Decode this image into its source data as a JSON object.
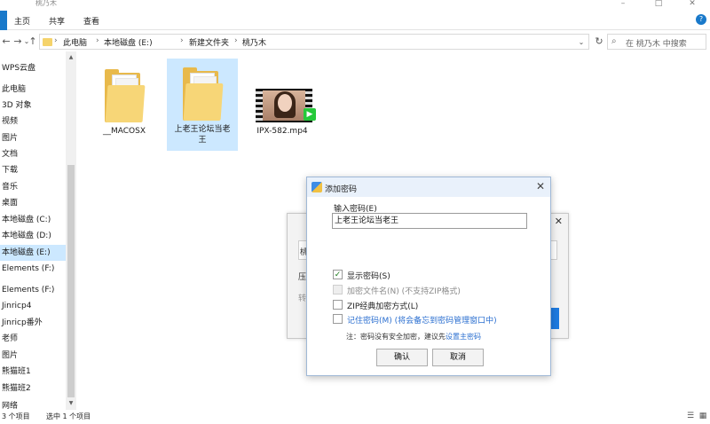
{
  "window": {
    "title": "桃乃木",
    "controls": {
      "minimize": "–",
      "maximize": "□",
      "close": "✕"
    }
  },
  "ribbon": {
    "tabs": [
      "主页",
      "共享",
      "查看"
    ],
    "help": "?"
  },
  "address": {
    "crumbs": [
      "此电脑",
      "本地磁盘 (E:)",
      "新建文件夹",
      "桃乃木"
    ],
    "separator": "›",
    "dropdown": "⌄",
    "refresh": "↻"
  },
  "search": {
    "placeholder": "在 桃乃木 中搜索",
    "icon": "search-icon"
  },
  "nav": {
    "back": "←",
    "forward": "→",
    "recent": "⌄",
    "up": "↑"
  },
  "sidebar": {
    "items": [
      {
        "label": "WPS云盘",
        "selected": false
      },
      {
        "label": "此电脑",
        "selected": false
      },
      {
        "label": "3D 对象",
        "selected": false
      },
      {
        "label": "视频",
        "selected": false
      },
      {
        "label": "图片",
        "selected": false
      },
      {
        "label": "文档",
        "selected": false
      },
      {
        "label": "下载",
        "selected": false
      },
      {
        "label": "音乐",
        "selected": false
      },
      {
        "label": "桌面",
        "selected": false
      },
      {
        "label": "本地磁盘 (C:)",
        "selected": false
      },
      {
        "label": "本地磁盘 (D:)",
        "selected": false
      },
      {
        "label": "本地磁盘 (E:)",
        "selected": true
      },
      {
        "label": "Elements (F:)",
        "selected": false
      },
      {
        "label": "Elements (F:)",
        "selected": false
      },
      {
        "label": "Jinricp4",
        "selected": false
      },
      {
        "label": "Jinricp番外",
        "selected": false
      },
      {
        "label": "老师",
        "selected": false
      },
      {
        "label": "图片",
        "selected": false
      },
      {
        "label": "熊猫班1",
        "selected": false
      },
      {
        "label": "熊猫班2",
        "selected": false
      },
      {
        "label": "网络",
        "selected": false
      }
    ]
  },
  "files": [
    {
      "name": "__MACOSX",
      "kind": "folder",
      "selected": false
    },
    {
      "name": "上老王论坛当老王",
      "kind": "folder",
      "selected": true
    },
    {
      "name": "IPX-582.mp4",
      "kind": "video",
      "selected": false
    }
  ],
  "bg_dialog": {
    "close": "✕",
    "char1": "桃",
    "char2": "压",
    "char3": "转"
  },
  "dialog": {
    "title": "添加密码",
    "close": "✕",
    "password_label": "输入密码(E)",
    "password_value": "上老王论坛当老王",
    "show_password": {
      "label": "显示密码(S)",
      "checked": true
    },
    "encrypt_names": {
      "label": "加密文件名(N) (不支持ZIP格式)",
      "enabled": false
    },
    "zip_classic": {
      "label": "ZIP经典加密方式(L)",
      "checked": false
    },
    "remember": {
      "label": "记住密码(M) (将会备忘到密码管理窗口中)",
      "checked": false
    },
    "note_prefix": "注：密码没有安全加密，建议先",
    "note_link": "设置主密码",
    "ok": "确认",
    "cancel": "取消"
  },
  "status": {
    "count": "3 个项目",
    "selected": "选中 1 个项目"
  }
}
